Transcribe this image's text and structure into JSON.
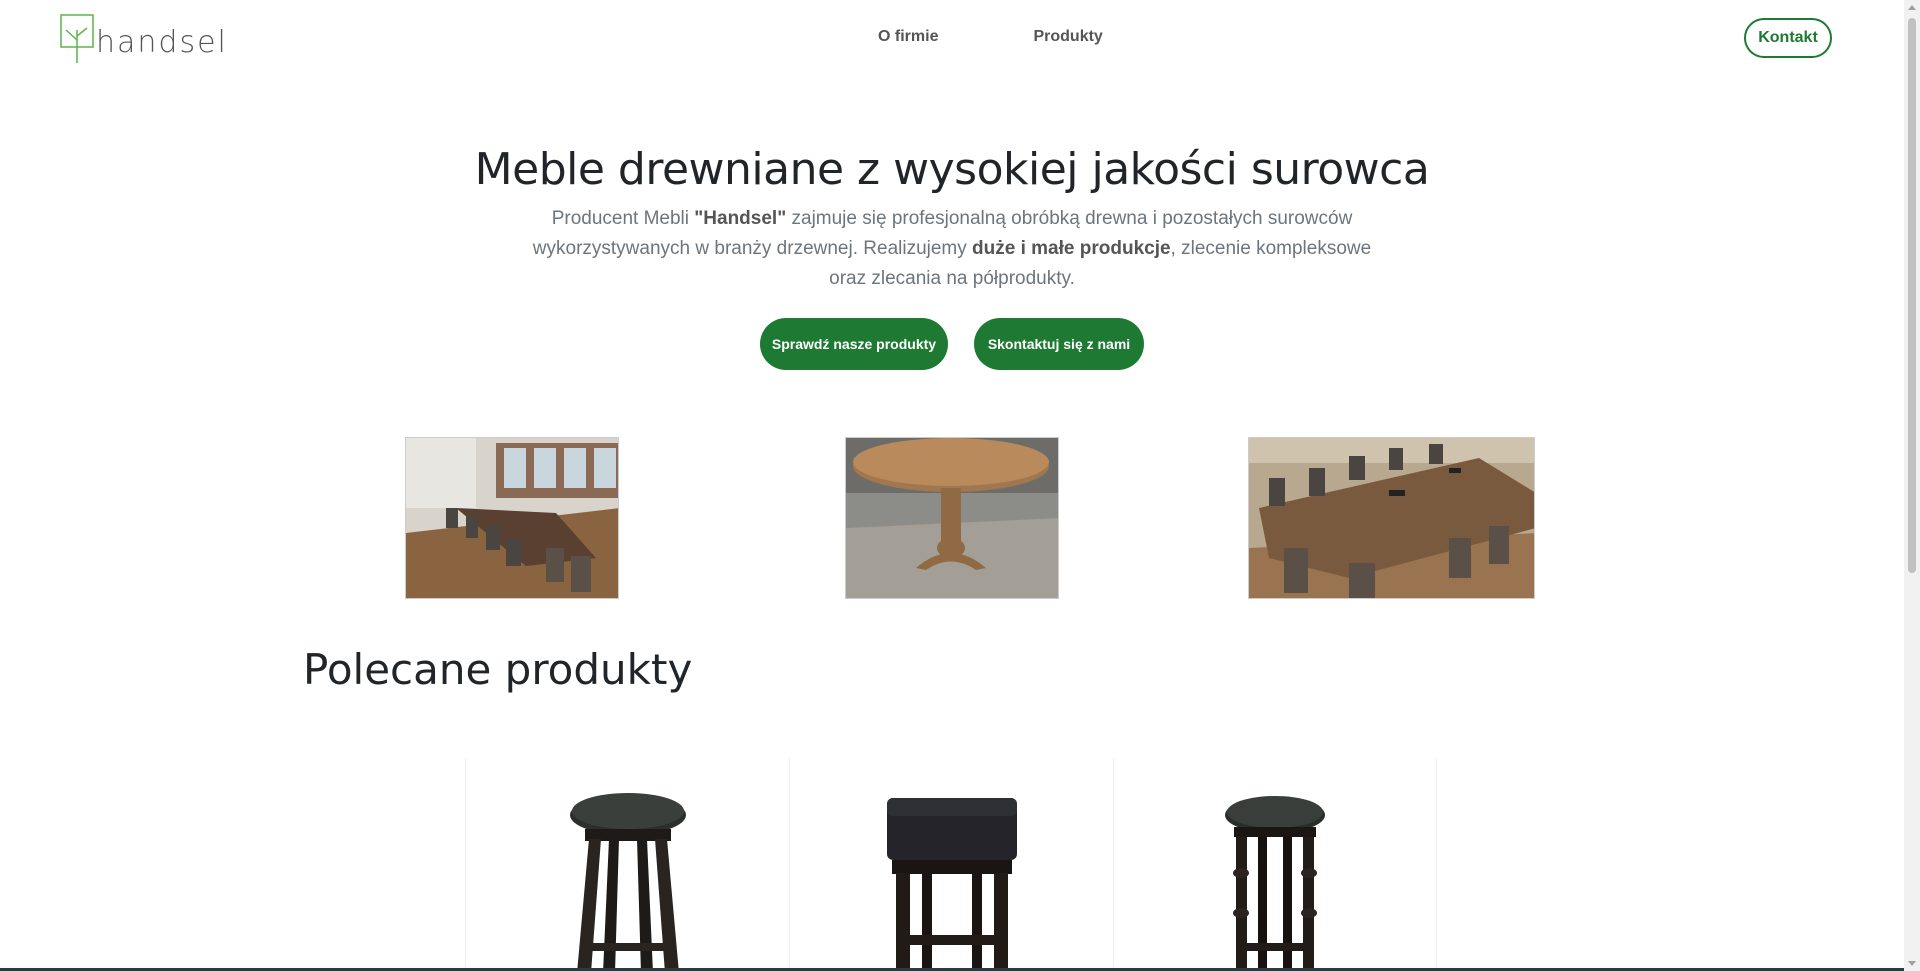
{
  "header": {
    "logo_text": "handsel",
    "nav": [
      "O firmie",
      "Produkty"
    ],
    "contact_button": "Kontakt"
  },
  "hero": {
    "title": "Meble drewniane z wysokiej jakości surowca",
    "desc_1": "Producent Mebli ",
    "desc_brand": "\"Handsel\"",
    "desc_2": " zajmuje się profesjonalną obróbką drewna i pozostałych surowców wykorzystywanych w branży drzewnej. Realizujemy ",
    "desc_bold": "duże i małe produkcje",
    "desc_3": ", zlecenie kompleksowe oraz zlecania na półprodukty.",
    "btn_products": "Sprawdź nasze produkty",
    "btn_contact": "Skontaktuj się z nami"
  },
  "section": {
    "title": "Polecane produkty"
  },
  "colors": {
    "accent": "#1e7a32"
  }
}
